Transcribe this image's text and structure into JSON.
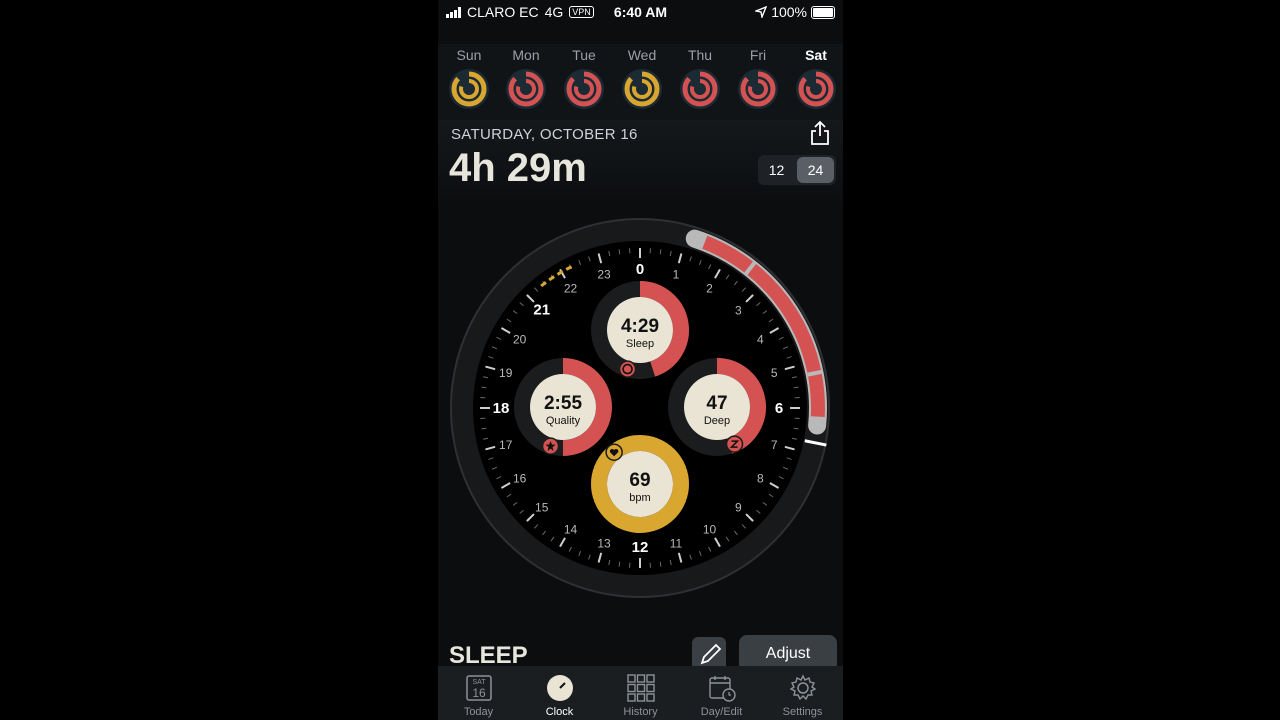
{
  "status_bar": {
    "carrier": "CLARO EC",
    "network": "4G",
    "vpn": "VPN",
    "time": "6:40 AM",
    "battery": "100%"
  },
  "days": [
    {
      "label": "Sun",
      "colors": [
        "#d9a630",
        "#d9a630"
      ],
      "active": false
    },
    {
      "label": "Mon",
      "colors": [
        "#d55252",
        "#d55252"
      ],
      "active": false
    },
    {
      "label": "Tue",
      "colors": [
        "#d55252",
        "#d55252"
      ],
      "active": false
    },
    {
      "label": "Wed",
      "colors": [
        "#d9a630",
        "#d9a630"
      ],
      "active": false
    },
    {
      "label": "Thu",
      "colors": [
        "#d55252",
        "#d55252"
      ],
      "active": false
    },
    {
      "label": "Fri",
      "colors": [
        "#d55252",
        "#d55252"
      ],
      "active": false
    },
    {
      "label": "Sat",
      "colors": [
        "#d55252",
        "#d55252"
      ],
      "active": true
    }
  ],
  "header": {
    "date": "SATURDAY, OCTOBER 16",
    "duration": "4h 29m",
    "format_12": "12",
    "format_24": "24",
    "format_selected": "24"
  },
  "clock": {
    "hours": [
      "0",
      "1",
      "2",
      "3",
      "4",
      "5",
      "6",
      "7",
      "8",
      "9",
      "10",
      "11",
      "12",
      "13",
      "14",
      "15",
      "16",
      "17",
      "18",
      "19",
      "20",
      "21",
      "22",
      "23"
    ],
    "sleep_start_hour": 1.5,
    "sleep_end_hour": 6.3,
    "metrics": {
      "sleep": {
        "value": "4:29",
        "label": "Sleep",
        "fraction": 0.45
      },
      "quality": {
        "value": "2:55",
        "label": "Quality",
        "fraction": 0.5
      },
      "deep": {
        "value": "47",
        "label": "Deep",
        "fraction": 0.45
      },
      "heart": {
        "value": "69",
        "label": "bpm",
        "fraction": 1.0
      }
    },
    "colors": {
      "red": "#d55252",
      "gold": "#d9a630",
      "cream": "#e9e4d4",
      "grey": "#b9b9b9"
    }
  },
  "bottom": {
    "section_title": "SLEEP",
    "adjust_label": "Adjust"
  },
  "tabs": [
    {
      "label": "Today",
      "icon": "calendar-today-icon",
      "badge_top": "SAT",
      "badge_num": "16"
    },
    {
      "label": "Clock",
      "icon": "clock-icon"
    },
    {
      "label": "History",
      "icon": "grid-icon"
    },
    {
      "label": "Day/Edit",
      "icon": "calendar-edit-icon"
    },
    {
      "label": "Settings",
      "icon": "gear-icon"
    }
  ],
  "selected_tab": "Clock"
}
